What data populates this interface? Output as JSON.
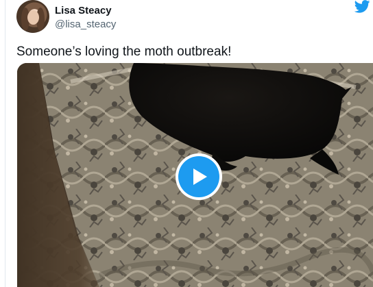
{
  "tweet": {
    "author": {
      "display_name": "Lisa Steacy",
      "handle": "@lisa_steacy"
    },
    "text": "Someone’s loving the moth outbreak!",
    "media": {
      "type": "video",
      "play_icon": "play-icon"
    }
  },
  "branding": {
    "logo_icon": "twitter-bird-icon",
    "logo_color": "#1d9bf0"
  },
  "colors": {
    "name_text": "#0f1419",
    "handle_text": "#536471",
    "accent": "#1d9bf0"
  }
}
